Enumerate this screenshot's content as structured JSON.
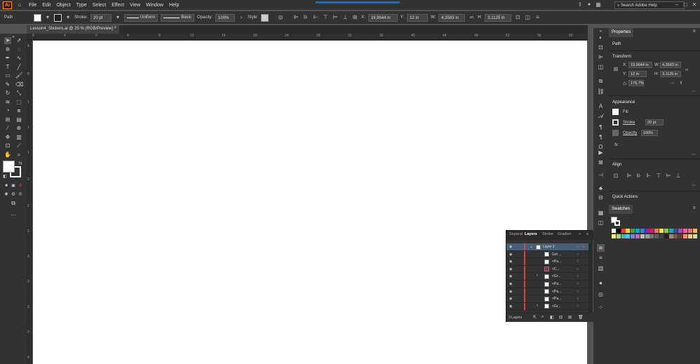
{
  "menubar": {
    "logo": "Ai",
    "items": [
      "File",
      "Edit",
      "Object",
      "Type",
      "Select",
      "Effect",
      "View",
      "Window",
      "Help"
    ],
    "search_placeholder": "Search Adobe Help"
  },
  "control": {
    "selection": "Path",
    "stroke_label": "Stroke:",
    "stroke_value": "20 pt",
    "profile": "Uniform",
    "brush": "Basic",
    "opacity_label": "Opacity:",
    "opacity_value": "100%",
    "style_label": "Style:",
    "x_label": "X:",
    "x_value": "19,9644 in",
    "y_label": "Y:",
    "y_value": "12 in",
    "w_label": "W:",
    "w_value": "4,3583 in",
    "h_label": "H:",
    "h_value": "3,1125 in"
  },
  "document": {
    "tab_title": "Lesson4_Stickers.ai @ 25 % (RGB/Preview)",
    "close": "×"
  },
  "ruler_top": [
    "8",
    "4",
    "0",
    "4",
    "8",
    "12",
    "16",
    "20",
    "24",
    "28",
    "32",
    "36",
    "40",
    "44",
    "48",
    "52",
    "56",
    "60"
  ],
  "ruler_left": [
    "4",
    "8",
    "1",
    "1",
    "1",
    "2",
    "2",
    "2",
    "3",
    "3",
    "3",
    "3",
    "4"
  ],
  "properties": {
    "tabs": [
      "Properties"
    ],
    "selection_type": "Path",
    "transform": {
      "title": "Transform",
      "x_label": "X:",
      "x": "19,9644 in",
      "y_label": "Y:",
      "y": "12 in",
      "w_label": "W:",
      "w": "4,3583 in",
      "h_label": "H:",
      "h": "3,1125 in",
      "angle_label": "△:",
      "angle": "175,7%"
    },
    "appearance": {
      "title": "Appearance",
      "fill": "Fill",
      "stroke": "Stroke",
      "stroke_value": "20 pt",
      "opacity": "Opacity",
      "opacity_value": "100%",
      "fx": "fx."
    },
    "align": {
      "title": "Align"
    },
    "quick_actions": {
      "title": "Quick Actions"
    }
  },
  "swatches": {
    "title": "Swatches",
    "colors": [
      "#ffffff",
      "#000000",
      "#e53935",
      "#fdd835",
      "#43a047",
      "#00acc1",
      "#1e88e5",
      "#8e24aa",
      "#d81b60",
      "#ff7043",
      "#ffeb3b",
      "#8bc34a",
      "#26a69a",
      "#3949ab",
      "#ab47bc",
      "#f06292",
      "#e57373",
      "#ffb74d",
      "#fff176",
      "#aed581",
      "#4db6ac",
      "#4fc3f7",
      "#7986cb",
      "#ba68c8",
      "#bdbdbd",
      "#9e9e9e",
      "#757575",
      "#616161",
      "#424242",
      "#212121",
      "#a1887f",
      "#795548",
      "#5d4037",
      "#ff8a65",
      "#ffcc80",
      "#c5e1a5"
    ]
  },
  "layers": {
    "tabs": [
      "Separat",
      "Layers",
      "Stroke",
      "Gradien"
    ],
    "active_tab": "Layers",
    "rows": [
      {
        "name": "Layer 2",
        "indent": 0
      },
      {
        "name": "Gol ...",
        "indent": 1
      },
      {
        "name": "<Pa...",
        "indent": 1
      },
      {
        "name": "<C...",
        "indent": 1
      },
      {
        "name": "<Gr...",
        "indent": 1
      },
      {
        "name": "<Pa...",
        "indent": 1
      },
      {
        "name": "<Pa...",
        "indent": 1
      },
      {
        "name": "<Pa...",
        "indent": 1
      },
      {
        "name": "<Gr...",
        "indent": 1
      }
    ],
    "footer": "3 Layers"
  }
}
